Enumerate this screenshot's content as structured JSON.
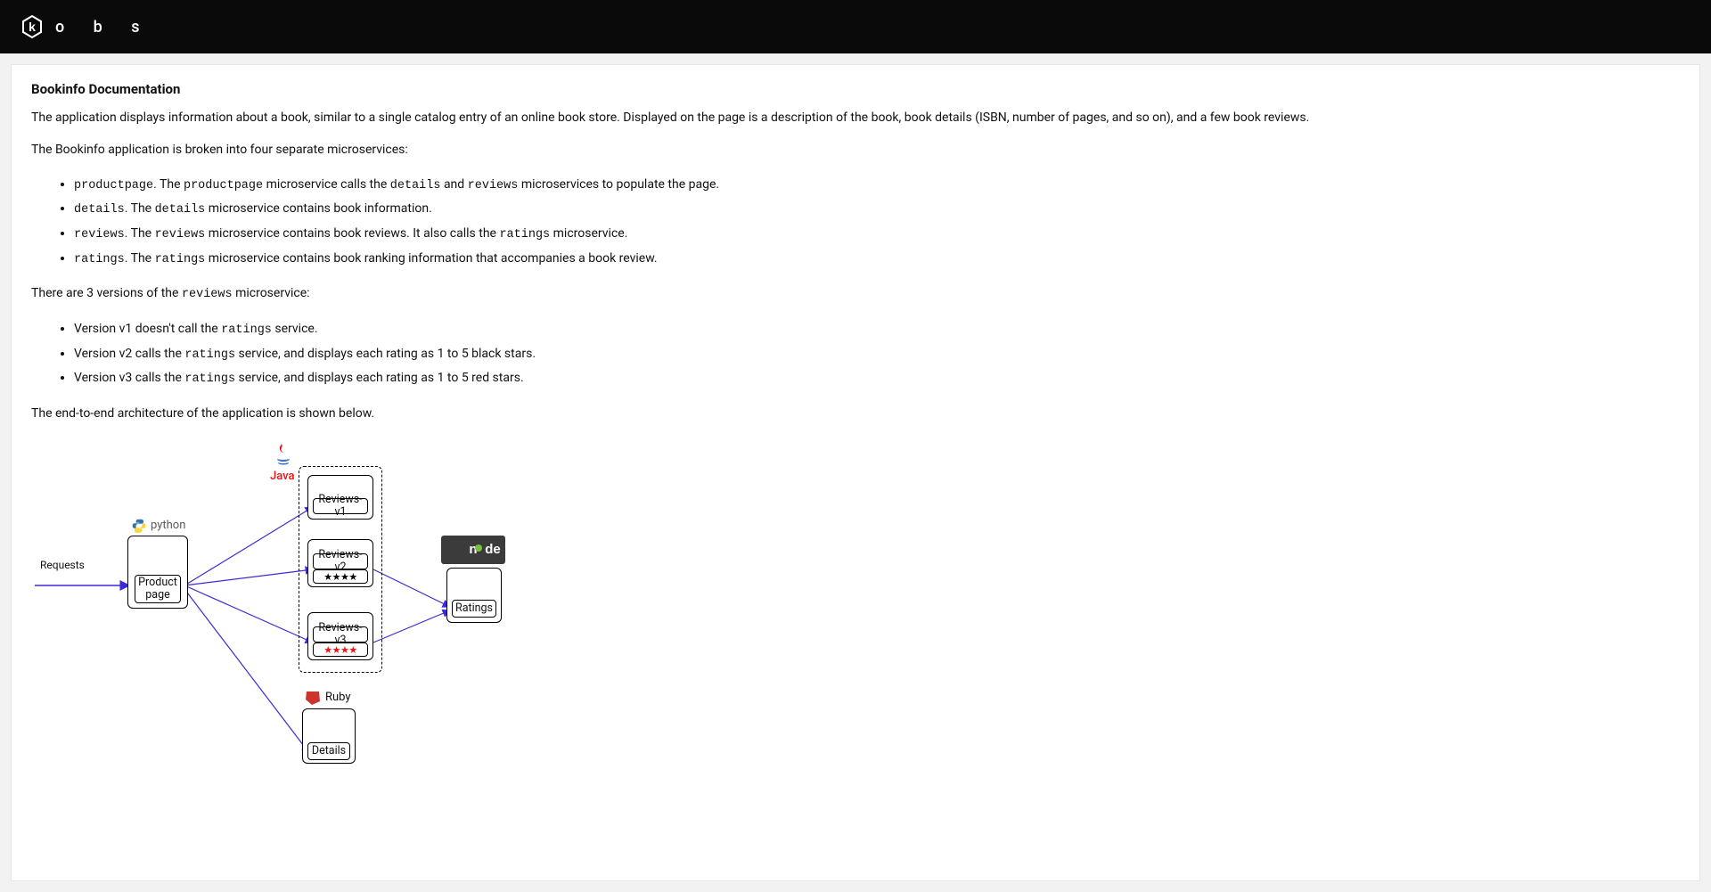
{
  "brand": {
    "letters": "o b s"
  },
  "doc": {
    "title": "Bookinfo Documentation",
    "intro": "The application displays information about a book, similar to a single catalog entry of an online book store. Displayed on the page is a description of the book, book details (ISBN, number of pages, and so on), and a few book reviews.",
    "broken_into": "The Bookinfo application is broken into four separate microservices:",
    "services": [
      {
        "name": "productpage",
        "desc_pre": ". The ",
        "desc_ref": "productpage",
        "desc_mid": " microservice calls the ",
        "desc_ref2": "details",
        "desc_and": " and ",
        "desc_ref3": "reviews",
        "desc_post": " microservices to populate the page."
      },
      {
        "name": "details",
        "desc_pre": ". The ",
        "desc_ref": "details",
        "desc_post": " microservice contains book information."
      },
      {
        "name": "reviews",
        "desc_pre": ". The ",
        "desc_ref": "reviews",
        "desc_mid": " microservice contains book reviews. It also calls the ",
        "desc_ref2": "ratings",
        "desc_post": " microservice."
      },
      {
        "name": "ratings",
        "desc_pre": ". The ",
        "desc_ref": "ratings",
        "desc_post": " microservice contains book ranking information that accompanies a book review."
      }
    ],
    "versions_intro_pre": "There are 3 versions of the ",
    "versions_intro_ref": "reviews",
    "versions_intro_post": " microservice:",
    "versions": [
      {
        "pre": "Version v1 doesn't call the ",
        "ref": "ratings",
        "post": " service."
      },
      {
        "pre": "Version v2 calls the ",
        "ref": "ratings",
        "post": " service, and displays each rating as 1 to 5 black stars."
      },
      {
        "pre": "Version v3 calls the ",
        "ref": "ratings",
        "post": " service, and displays each rating as 1 to 5 red stars."
      }
    ],
    "arch_line": "The end-to-end architecture of the application is shown below."
  },
  "diagram": {
    "requests": "Requests",
    "productpage": "Product page",
    "reviews_v1": "Reviews-v1",
    "reviews_v2": "Reviews-v2",
    "reviews_v3": "Reviews-v3",
    "ratings": "Ratings",
    "details": "Details",
    "lang_python": "python",
    "lang_java": "Java",
    "lang_ruby": "Ruby",
    "lang_node": "node",
    "stars_black": "★★★★",
    "stars_red": "★★★★"
  }
}
